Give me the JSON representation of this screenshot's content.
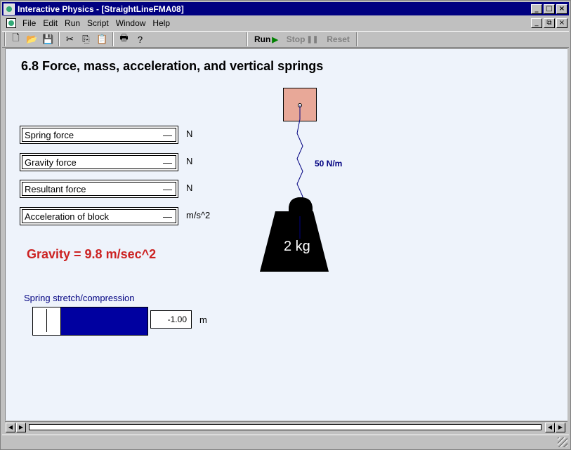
{
  "window": {
    "title": "Interactive Physics - [StraightLineFMA08]"
  },
  "menu": [
    "File",
    "Edit",
    "Run",
    "Script",
    "Window",
    "Help"
  ],
  "window_controls": {
    "minimize": "_",
    "maximize": "□",
    "close": "×",
    "restore": "⧉"
  },
  "toolbar": {
    "run_label": "Run",
    "stop_label": "Stop",
    "reset_label": "Reset"
  },
  "scene": {
    "title": "6.8 Force, mass, acceleration, and vertical springs",
    "meters": [
      {
        "label": "Spring force",
        "value": "—",
        "unit": "N"
      },
      {
        "label": "Gravity force",
        "value": "—",
        "unit": "N"
      },
      {
        "label": "Resultant force",
        "value": "—",
        "unit": "N"
      },
      {
        "label": "Acceleration of block",
        "value": "—",
        "unit": "m/s^2"
      }
    ],
    "gravity_text": "Gravity = 9.8 m/sec^2",
    "spring_label": "50 N/m",
    "weight_label": "2 kg",
    "slider": {
      "label": "Spring stretch/compression",
      "value": "-1.00",
      "unit": "m"
    }
  },
  "colors": {
    "titlebar": "#000080",
    "canvas": "#eef3fb",
    "block": "#e8a898",
    "gravity_text": "#cc2222",
    "slider_fill": "#0000a0"
  }
}
